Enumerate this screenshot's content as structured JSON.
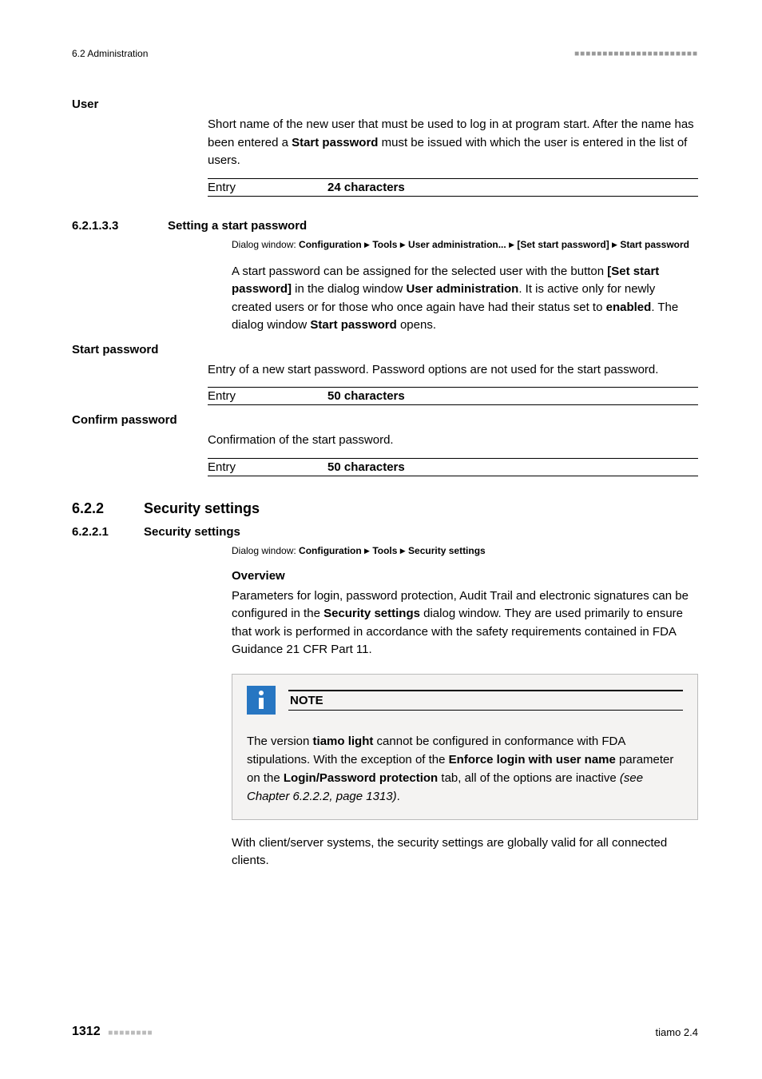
{
  "header": {
    "left": "6.2 Administration",
    "marks": "■■■■■■■■■■■■■■■■■■■■■■"
  },
  "user_section": {
    "label": "User",
    "para_pre": "Short name of the new user that must be used to log in at program start. After the name has been entered a ",
    "para_bold": "Start password",
    "para_post": " must be issued with which the user is entered in the list of users.",
    "entry_label": "Entry",
    "entry_value": "24 characters"
  },
  "sec_6_2_1_3_3": {
    "num": "6.2.1.3.3",
    "title": "Setting a start password",
    "dialog_prefix": "Dialog window: ",
    "path": [
      "Configuration",
      "Tools",
      "User administration...",
      "[Set start password]",
      "Start password"
    ],
    "para1_a": "A start password can be assigned for the selected user with the button ",
    "para1_b": "[Set start password]",
    "para1_c": " in the dialog window ",
    "para1_d": "User administration",
    "para1_e": ". It is active only for newly created users or for those who once again have had their status set to ",
    "para1_f": "enabled",
    "para1_g": ". The dialog window ",
    "para1_h": "Start password",
    "para1_i": " opens."
  },
  "start_password": {
    "label": "Start password",
    "para": "Entry of a new start password. Password options are not used for the start password.",
    "entry_label": "Entry",
    "entry_value": "50 characters"
  },
  "confirm_password": {
    "label": "Confirm password",
    "para": "Confirmation of the start password.",
    "entry_label": "Entry",
    "entry_value": "50 characters"
  },
  "sec_6_2_2": {
    "num": "6.2.2",
    "title": "Security settings"
  },
  "sec_6_2_2_1": {
    "num": "6.2.2.1",
    "title": "Security settings",
    "dialog_prefix": "Dialog window: ",
    "path": [
      "Configuration",
      "Tools",
      "Security settings"
    ],
    "overview": "Overview",
    "para_a": "Parameters for login, password protection, Audit Trail and electronic signatures can be configured in the ",
    "para_b": "Security settings",
    "para_c": " dialog window. They are used primarily to ensure that work is performed in accordance with the safety requirements contained in FDA Guidance 21 CFR Part 11."
  },
  "note": {
    "title": "NOTE",
    "a": "The version ",
    "b": "tiamo light",
    "c": " cannot be configured in conformance with FDA stipulations. With the exception of the ",
    "d": "Enforce login with user name",
    "e": " parameter on the ",
    "f": "Login/Password protection",
    "g": " tab, all of the options are inactive ",
    "h": "(see Chapter 6.2.2.2, page 1313)",
    "i": "."
  },
  "closing_para": "With client/server systems, the security settings are globally valid for all connected clients.",
  "footer": {
    "page": "1312",
    "marks": "■■■■■■■■",
    "product": "tiamo 2.4"
  }
}
